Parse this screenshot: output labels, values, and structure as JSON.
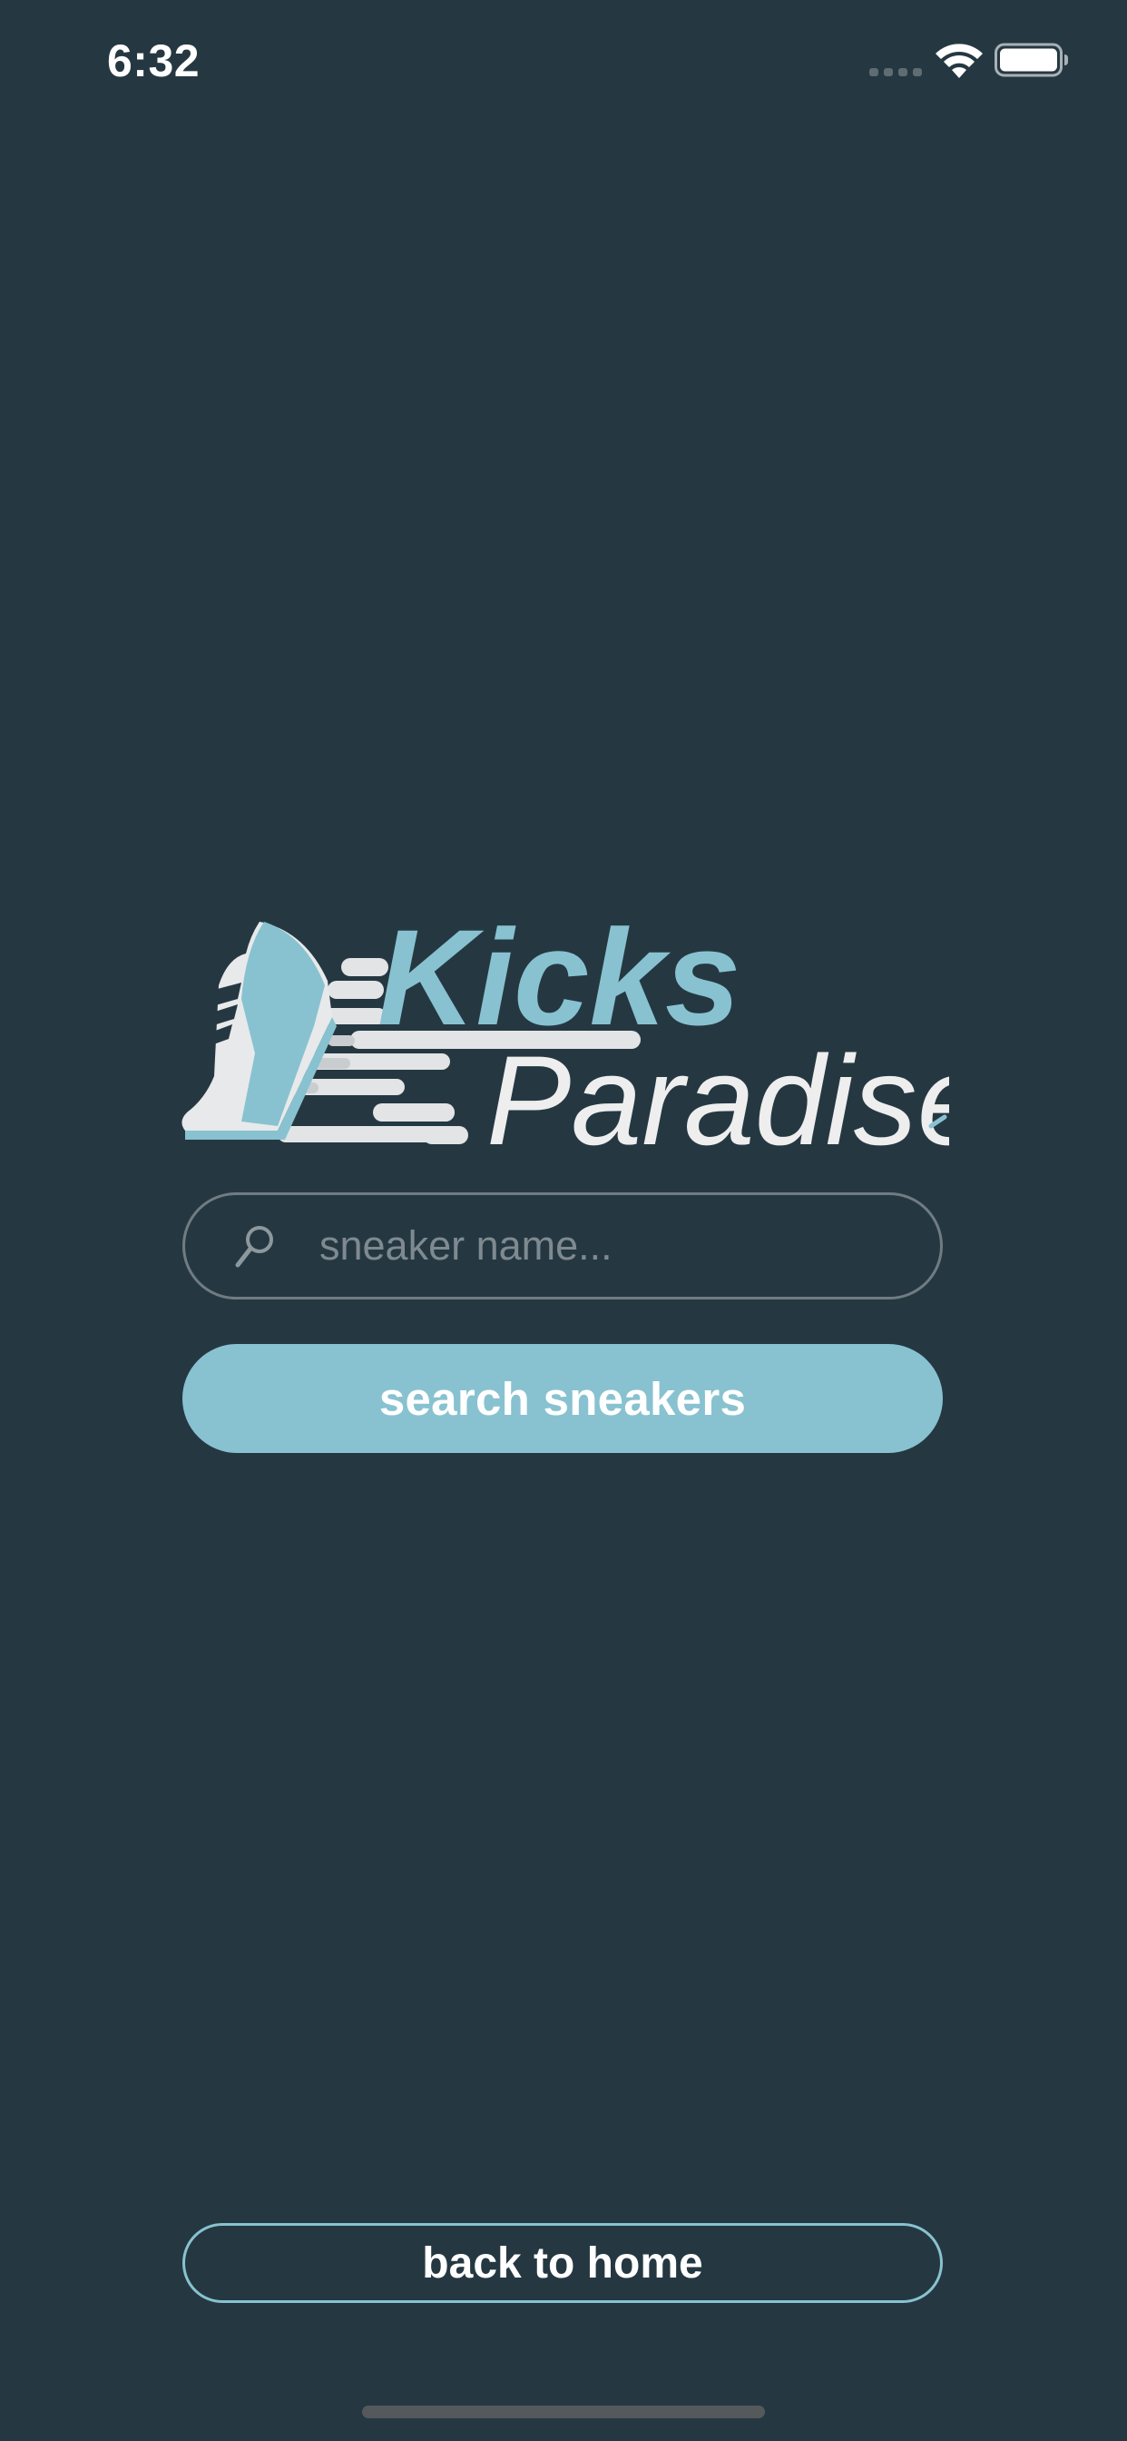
{
  "status_bar": {
    "time": "6:32"
  },
  "logo": {
    "line1": "Kicks",
    "line2": "Paradise"
  },
  "search": {
    "placeholder": "sneaker name...",
    "value": "",
    "icon": "search-icon"
  },
  "buttons": {
    "search_label": "search sneakers",
    "back_label": "back to home"
  },
  "colors": {
    "background": "#253842",
    "accent": "#88c2d0",
    "text": "#ffffff",
    "placeholder": "#7f8a90"
  }
}
